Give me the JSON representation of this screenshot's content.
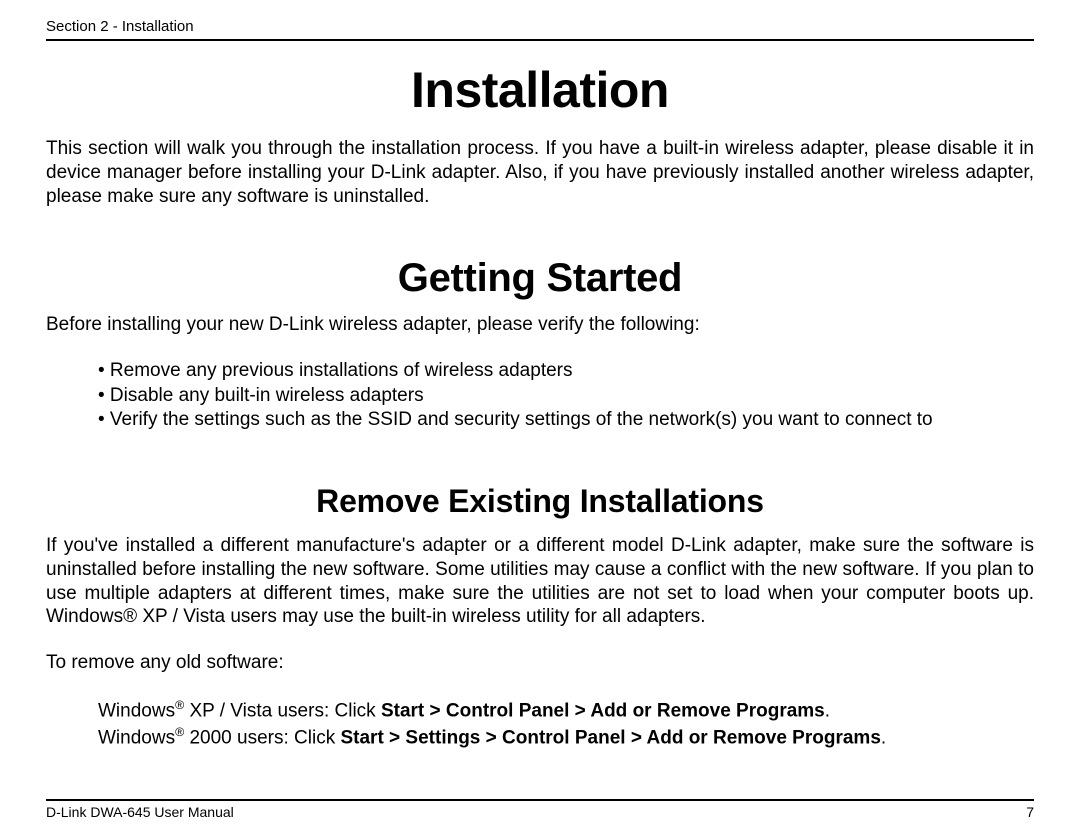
{
  "header": {
    "section_label": "Section 2 - Installation"
  },
  "title_installation": "Installation",
  "intro": "This section will walk you through the installation process. If you have a built-in wireless adapter, please disable it in device manager before installing your D-Link adapter. Also, if you have previously installed another wireless adapter, please make sure any software is uninstalled.",
  "title_getting_started": "Getting Started",
  "getting_started_intro": "Before installing your new D-Link wireless adapter, please verify the following:",
  "bullets": [
    "• Remove any previous installations of wireless adapters",
    "• Disable any built-in wireless adapters",
    "• Verify the settings such as the SSID and security settings of the network(s) you want to connect to"
  ],
  "title_remove": "Remove Existing Installations",
  "remove_para": "If you've installed a different manufacture's adapter or a different model D-Link adapter, make sure the software is uninstalled before installing the new software. Some utilities may cause a conflict with the new software. If you plan to use multiple adapters at different times, make sure the utilities are not set to load when your computer boots up. Windows® XP / Vista users may use the built-in wireless utility for all adapters.",
  "remove_prompt": "To remove any old software:",
  "instructions": {
    "xp_vista": {
      "prefix": "Windows",
      "reg": "®",
      "mid": " XP / Vista users:  Click ",
      "path": "Start > Control Panel > Add or Remove Programs",
      "suffix": "."
    },
    "win2000": {
      "prefix": "Windows",
      "reg": "®",
      "mid": " 2000 users: Click ",
      "path": "Start > Settings > Control Panel > Add or Remove Programs",
      "suffix": "."
    }
  },
  "footer": {
    "manual_label": "D-Link DWA-645 User Manual",
    "page_number": "7"
  }
}
